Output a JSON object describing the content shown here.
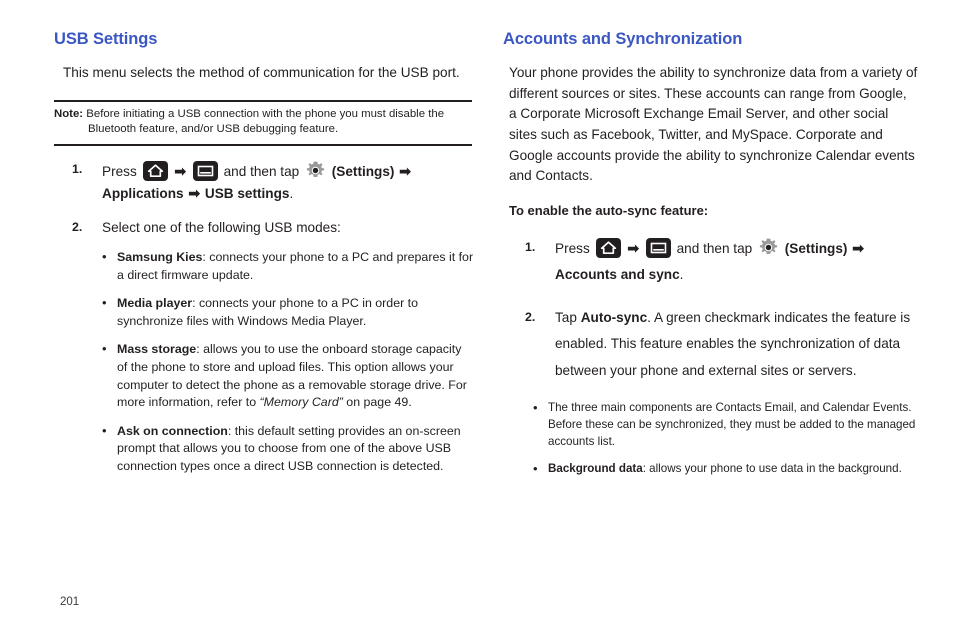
{
  "page": {
    "number": "201"
  },
  "left_column": {
    "title": "USB Settings",
    "intro": "This menu selects the method of communication for the USB port.",
    "note": {
      "label": "Note:",
      "text": "Before initiating a USB connection with the phone you must disable the Bluetooth feature, and/or USB debugging feature."
    },
    "step1": {
      "number": "1.",
      "press": "Press",
      "and_then_tap": "and then tap",
      "settings_paren": "(Settings)",
      "applications": "Applications",
      "usb_settings": "USB settings",
      "period": "."
    },
    "step2": {
      "number": "2.",
      "text": "Select one of the following USB modes:"
    },
    "modes": [
      {
        "term": "Samsung Kies",
        "desc": ": connects your phone to a PC and prepares it for a direct firmware update."
      },
      {
        "term": "Media player",
        "desc": ": connects your phone to a PC in order to synchronize files with Windows Media Player."
      },
      {
        "term": "Mass storage",
        "desc": ": allows you to use the onboard storage capacity of the phone to store and upload files. This option allows your computer to detect the phone as a removable storage drive. For more information, refer to ",
        "ref_italic": "“Memory Card”",
        "desc_tail": " on page 49."
      },
      {
        "term": "Ask on connection",
        "desc": ": this default setting provides an on-screen prompt that allows you to choose from one of the above USB connection types once a direct USB connection is detected."
      }
    ]
  },
  "right_column": {
    "title": "Accounts and Synchronization",
    "intro": "Your phone provides the ability to synchronize data from a variety of different sources or sites. These accounts can range from Google, a Corporate Microsoft Exchange Email Server, and other social sites such as Facebook, Twitter, and MySpace. Corporate and Google accounts provide the ability to synchronize Calendar events and Contacts.",
    "subhead": "To enable the auto-sync feature:",
    "step1": {
      "number": "1.",
      "press": "Press",
      "and_then_tap": "and then tap",
      "settings_paren": "(Settings)",
      "accounts_and_sync": "Accounts and sync",
      "period": "."
    },
    "step2": {
      "number": "2.",
      "tap": "Tap",
      "auto_sync": "Auto-sync",
      "text_tail": ". A green checkmark indicates the feature is enabled. This feature enables the synchronization of data between your phone and external sites or servers."
    },
    "sub_bullets": [
      {
        "term": "",
        "desc": "The three main components are Contacts Email, and Calendar Events. Before these can be synchronized, they must be added to the managed accounts list."
      },
      {
        "term": "Background data",
        "desc": ": allows your phone to use data in the background."
      }
    ]
  },
  "icons": {
    "home": "home-key-icon",
    "menu": "menu-key-icon",
    "gear": "settings-gear-icon",
    "arrow": "➡"
  },
  "colors": {
    "heading_blue": "#3b57c4",
    "body_text": "#231f20",
    "icon_dark": "#231f20",
    "gear_gray": "#8c8c8c"
  }
}
